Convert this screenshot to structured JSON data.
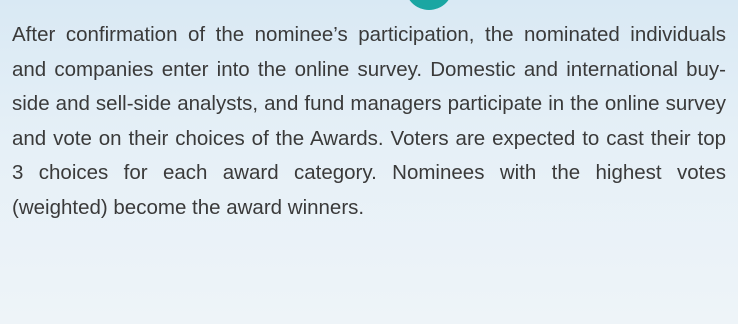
{
  "paragraph": "After confirmation of the nominee’s participation, the nominated individuals and companies enter into the online survey. Domestic and international buy-side and sell-side analysts, and fund managers participate in the online survey and vote on their choices of the Awards. Voters are expected to cast their top 3 choices for each award category. Nominees with the highest votes (weighted) become the award winners.",
  "colors": {
    "background_top": "#d9e9f4",
    "background_bottom": "#eef4f8",
    "text": "#3a3a3a",
    "accent_marker": "#1aa6a2"
  }
}
